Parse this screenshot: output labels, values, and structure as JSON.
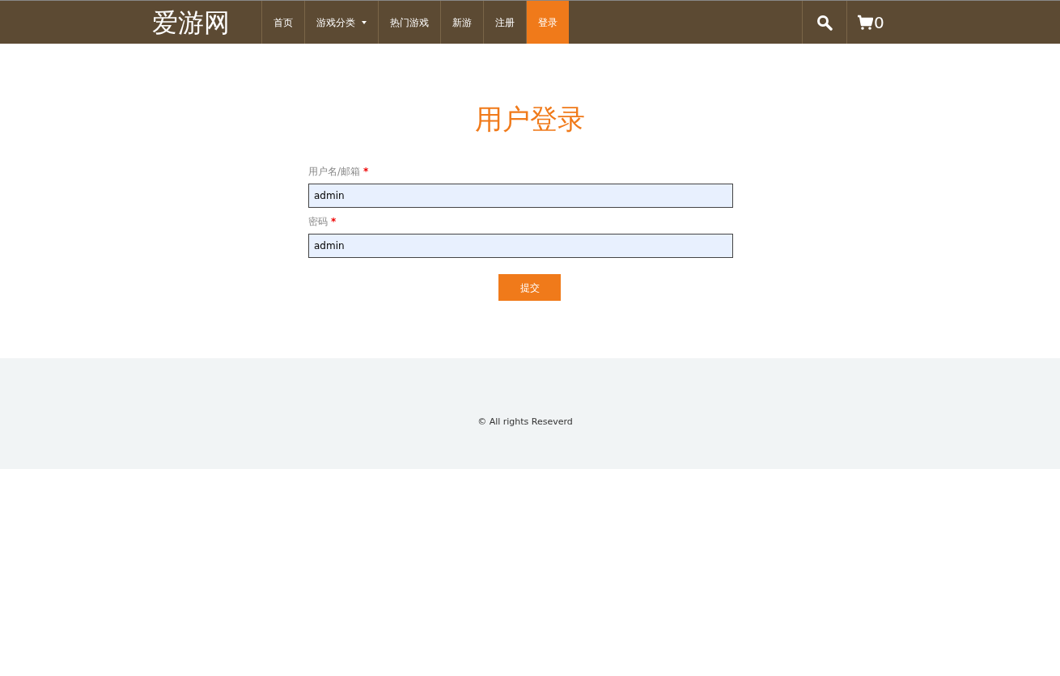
{
  "navbar": {
    "brand": "爱游网",
    "items": [
      {
        "label": "首页",
        "selected": false,
        "dropdown": false
      },
      {
        "label": "游戏分类",
        "selected": false,
        "dropdown": true
      },
      {
        "label": "热门游戏",
        "selected": false,
        "dropdown": false
      },
      {
        "label": "新游",
        "selected": false,
        "dropdown": false
      },
      {
        "label": "注册",
        "selected": false,
        "dropdown": false
      },
      {
        "label": "登录",
        "selected": true,
        "dropdown": false
      }
    ],
    "cart_count": "0"
  },
  "login": {
    "title": "用户登录",
    "fields": [
      {
        "label": "用户名/邮箱",
        "required_mark": "*",
        "value": "admin"
      },
      {
        "label": "密码",
        "required_mark": "*",
        "value": "admin"
      }
    ],
    "submit": "提交"
  },
  "footer": {
    "text": "© All rights Reseverd"
  }
}
